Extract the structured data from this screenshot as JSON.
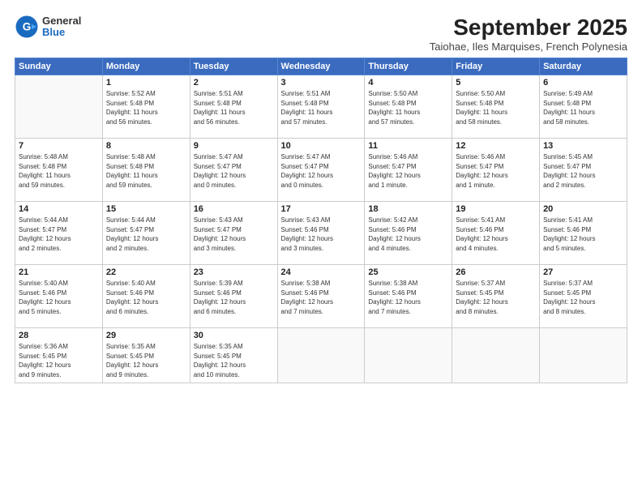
{
  "header": {
    "logo_general": "General",
    "logo_blue": "Blue",
    "title": "September 2025",
    "location": "Taiohae, Iles Marquises, French Polynesia"
  },
  "weekdays": [
    "Sunday",
    "Monday",
    "Tuesday",
    "Wednesday",
    "Thursday",
    "Friday",
    "Saturday"
  ],
  "weeks": [
    [
      {
        "day": "",
        "info": ""
      },
      {
        "day": "1",
        "info": "Sunrise: 5:52 AM\nSunset: 5:48 PM\nDaylight: 11 hours\nand 56 minutes."
      },
      {
        "day": "2",
        "info": "Sunrise: 5:51 AM\nSunset: 5:48 PM\nDaylight: 11 hours\nand 56 minutes."
      },
      {
        "day": "3",
        "info": "Sunrise: 5:51 AM\nSunset: 5:48 PM\nDaylight: 11 hours\nand 57 minutes."
      },
      {
        "day": "4",
        "info": "Sunrise: 5:50 AM\nSunset: 5:48 PM\nDaylight: 11 hours\nand 57 minutes."
      },
      {
        "day": "5",
        "info": "Sunrise: 5:50 AM\nSunset: 5:48 PM\nDaylight: 11 hours\nand 58 minutes."
      },
      {
        "day": "6",
        "info": "Sunrise: 5:49 AM\nSunset: 5:48 PM\nDaylight: 11 hours\nand 58 minutes."
      }
    ],
    [
      {
        "day": "7",
        "info": "Sunrise: 5:48 AM\nSunset: 5:48 PM\nDaylight: 11 hours\nand 59 minutes."
      },
      {
        "day": "8",
        "info": "Sunrise: 5:48 AM\nSunset: 5:48 PM\nDaylight: 11 hours\nand 59 minutes."
      },
      {
        "day": "9",
        "info": "Sunrise: 5:47 AM\nSunset: 5:47 PM\nDaylight: 12 hours\nand 0 minutes."
      },
      {
        "day": "10",
        "info": "Sunrise: 5:47 AM\nSunset: 5:47 PM\nDaylight: 12 hours\nand 0 minutes."
      },
      {
        "day": "11",
        "info": "Sunrise: 5:46 AM\nSunset: 5:47 PM\nDaylight: 12 hours\nand 1 minute."
      },
      {
        "day": "12",
        "info": "Sunrise: 5:46 AM\nSunset: 5:47 PM\nDaylight: 12 hours\nand 1 minute."
      },
      {
        "day": "13",
        "info": "Sunrise: 5:45 AM\nSunset: 5:47 PM\nDaylight: 12 hours\nand 2 minutes."
      }
    ],
    [
      {
        "day": "14",
        "info": "Sunrise: 5:44 AM\nSunset: 5:47 PM\nDaylight: 12 hours\nand 2 minutes."
      },
      {
        "day": "15",
        "info": "Sunrise: 5:44 AM\nSunset: 5:47 PM\nDaylight: 12 hours\nand 2 minutes."
      },
      {
        "day": "16",
        "info": "Sunrise: 5:43 AM\nSunset: 5:47 PM\nDaylight: 12 hours\nand 3 minutes."
      },
      {
        "day": "17",
        "info": "Sunrise: 5:43 AM\nSunset: 5:46 PM\nDaylight: 12 hours\nand 3 minutes."
      },
      {
        "day": "18",
        "info": "Sunrise: 5:42 AM\nSunset: 5:46 PM\nDaylight: 12 hours\nand 4 minutes."
      },
      {
        "day": "19",
        "info": "Sunrise: 5:41 AM\nSunset: 5:46 PM\nDaylight: 12 hours\nand 4 minutes."
      },
      {
        "day": "20",
        "info": "Sunrise: 5:41 AM\nSunset: 5:46 PM\nDaylight: 12 hours\nand 5 minutes."
      }
    ],
    [
      {
        "day": "21",
        "info": "Sunrise: 5:40 AM\nSunset: 5:46 PM\nDaylight: 12 hours\nand 5 minutes."
      },
      {
        "day": "22",
        "info": "Sunrise: 5:40 AM\nSunset: 5:46 PM\nDaylight: 12 hours\nand 6 minutes."
      },
      {
        "day": "23",
        "info": "Sunrise: 5:39 AM\nSunset: 5:46 PM\nDaylight: 12 hours\nand 6 minutes."
      },
      {
        "day": "24",
        "info": "Sunrise: 5:38 AM\nSunset: 5:46 PM\nDaylight: 12 hours\nand 7 minutes."
      },
      {
        "day": "25",
        "info": "Sunrise: 5:38 AM\nSunset: 5:46 PM\nDaylight: 12 hours\nand 7 minutes."
      },
      {
        "day": "26",
        "info": "Sunrise: 5:37 AM\nSunset: 5:45 PM\nDaylight: 12 hours\nand 8 minutes."
      },
      {
        "day": "27",
        "info": "Sunrise: 5:37 AM\nSunset: 5:45 PM\nDaylight: 12 hours\nand 8 minutes."
      }
    ],
    [
      {
        "day": "28",
        "info": "Sunrise: 5:36 AM\nSunset: 5:45 PM\nDaylight: 12 hours\nand 9 minutes."
      },
      {
        "day": "29",
        "info": "Sunrise: 5:35 AM\nSunset: 5:45 PM\nDaylight: 12 hours\nand 9 minutes."
      },
      {
        "day": "30",
        "info": "Sunrise: 5:35 AM\nSunset: 5:45 PM\nDaylight: 12 hours\nand 10 minutes."
      },
      {
        "day": "",
        "info": ""
      },
      {
        "day": "",
        "info": ""
      },
      {
        "day": "",
        "info": ""
      },
      {
        "day": "",
        "info": ""
      }
    ]
  ]
}
